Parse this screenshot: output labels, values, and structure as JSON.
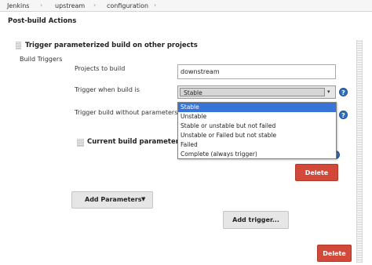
{
  "breadcrumbs": [
    "Jenkins",
    "upstream",
    "configuration"
  ],
  "section_title": "Post-build Actions",
  "step": {
    "title": "Trigger parameterized build on other projects",
    "build_triggers_label": "Build Triggers",
    "projects_label": "Projects to build",
    "projects_value": "downstream",
    "trigger_when_label": "Trigger when build is",
    "trigger_when_selected": "Stable",
    "trigger_when_options": [
      "Stable",
      "Unstable",
      "Stable or unstable but not failed",
      "Unstable or Failed but not stable",
      "Failed",
      "Complete (always trigger)"
    ],
    "without_params_label": "Trigger build without parameters",
    "current_params_label": "Current build parameters",
    "delete_label": "Delete",
    "add_parameters_label": "Add Parameters",
    "add_trigger_label": "Add trigger...",
    "outer_delete_label": "Delete"
  },
  "icons": {
    "help": "help-icon",
    "dropdown_arrow": "chevron-down-icon",
    "drag": "drag-handle-icon"
  },
  "colors": {
    "delete_red": "#d24939",
    "selected_blue": "#3874d8",
    "help_blue": "#2f6fc0"
  }
}
